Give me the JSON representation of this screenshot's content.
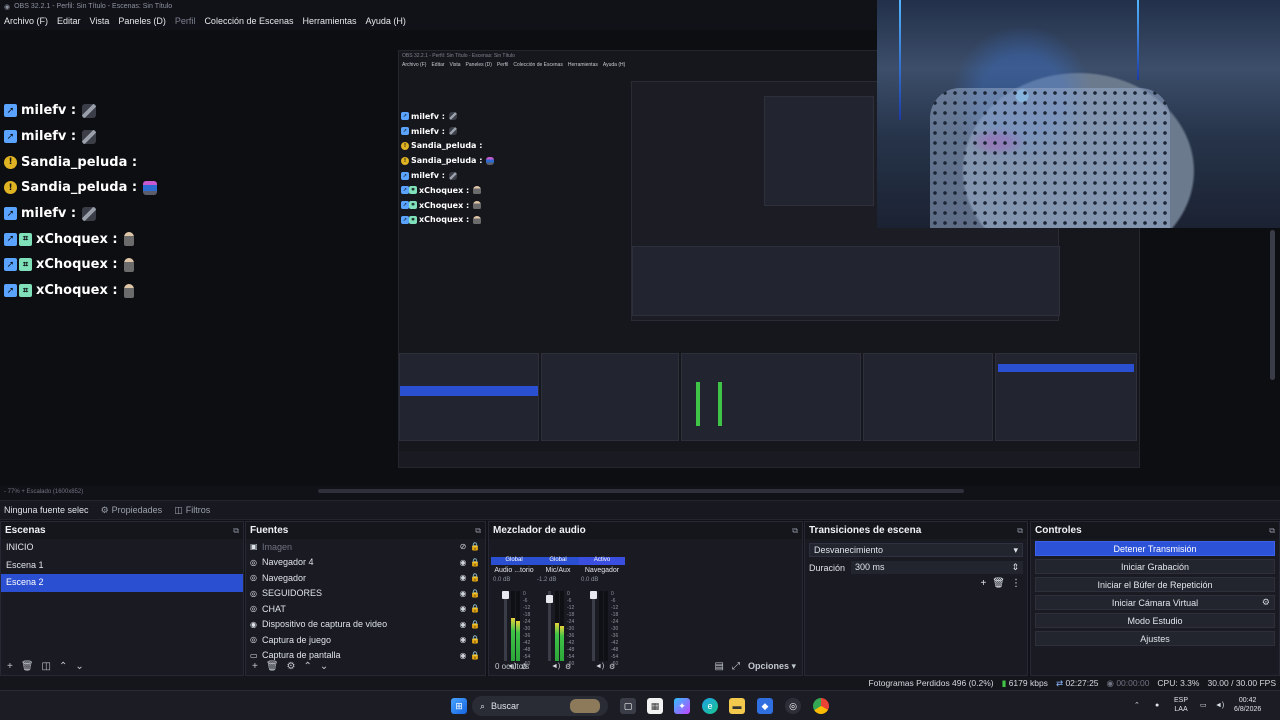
{
  "window": {
    "title": "OBS 32.2.1 - Perfil: Sin Título - Escenas: Sin Título"
  },
  "menu": [
    {
      "label": "Archivo (F)",
      "dim": false
    },
    {
      "label": "Editar",
      "dim": false
    },
    {
      "label": "Vista",
      "dim": false
    },
    {
      "label": "Paneles (D)",
      "dim": false
    },
    {
      "label": "Perfil",
      "dim": true
    },
    {
      "label": "Colección de Escenas",
      "dim": false
    },
    {
      "label": "Herramientas",
      "dim": false
    },
    {
      "label": "Ayuda (H)",
      "dim": false
    }
  ],
  "chat": [
    {
      "user": "milefv :",
      "badges": [
        "prime"
      ],
      "emote": "sword"
    },
    {
      "user": "milefv :",
      "badges": [
        "prime"
      ],
      "emote": "sword"
    },
    {
      "user": "Sandia_peluda :",
      "badges": [
        "sub"
      ],
      "emote": "none"
    },
    {
      "user": "Sandia_peluda :",
      "badges": [
        "sub"
      ],
      "emote": "robo"
    },
    {
      "user": "milefv :",
      "badges": [
        "prime"
      ],
      "emote": "sword"
    },
    {
      "user": "xChoquex :",
      "badges": [
        "prime",
        "extra"
      ],
      "emote": "fig"
    },
    {
      "user": "xChoquex :",
      "badges": [
        "prime",
        "extra"
      ],
      "emote": "fig"
    },
    {
      "user": "xChoquex :",
      "badges": [
        "prime",
        "extra"
      ],
      "emote": "fig"
    }
  ],
  "preview_strip": {
    "zoom": "- 77% + Escalado (1600x852)"
  },
  "propbar": {
    "selected": "Ninguna fuente selec",
    "properties": "Propiedades",
    "filters": "Filtros"
  },
  "scenes": {
    "title": "Escenas",
    "items": [
      {
        "label": "INICIO",
        "selected": false
      },
      {
        "label": "Escena 1",
        "selected": false
      },
      {
        "label": "Escena 2",
        "selected": true
      }
    ]
  },
  "sources": {
    "title": "Fuentes",
    "items": [
      {
        "label": "Imagen",
        "icon": "image-icon",
        "dim": true
      },
      {
        "label": "Navegador 4",
        "icon": "globe-icon",
        "dim": false
      },
      {
        "label": "Navegador",
        "icon": "globe-icon",
        "dim": false
      },
      {
        "label": "SEGUIDORES",
        "icon": "globe-icon",
        "dim": false
      },
      {
        "label": "CHAT",
        "icon": "globe-icon",
        "dim": false
      },
      {
        "label": "Dispositivo de captura de video",
        "icon": "camera-icon",
        "dim": false
      },
      {
        "label": "Captura de juego",
        "icon": "gamepad-icon",
        "dim": false
      },
      {
        "label": "Captura de pantalla",
        "icon": "monitor-icon",
        "dim": false
      }
    ]
  },
  "mixer": {
    "title": "Mezclador de audio",
    "channels": [
      {
        "tag": "Global",
        "name": "Audio ...torio",
        "db": "0.0 dB",
        "level": 0.62
      },
      {
        "tag": "Global",
        "name": "Mic/Aux",
        "db": "-1.2 dB",
        "level": 0.55
      },
      {
        "tag": "Activo",
        "name": "Navegador",
        "db": "0.0 dB",
        "level": 0.0
      }
    ],
    "scale": [
      "0",
      "-6",
      "-12",
      "-18",
      "-24",
      "-30",
      "-36",
      "-42",
      "-48",
      "-54",
      "-60"
    ],
    "hidden": "0 oculto/s",
    "options": "Opciones"
  },
  "transitions": {
    "title": "Transiciones de escena",
    "type": "Desvanecimiento",
    "duration_label": "Duración",
    "duration_value": "300 ms"
  },
  "controls": {
    "title": "Controles",
    "buttons": [
      {
        "label": "Detener Transmisión",
        "primary": true
      },
      {
        "label": "Iniciar Grabación",
        "primary": false
      },
      {
        "label": "Iniciar el Búfer de Repetición",
        "primary": false
      },
      {
        "label": "Iniciar Cámara Virtual",
        "primary": false
      },
      {
        "label": "Modo Estudio",
        "primary": false
      },
      {
        "label": "Ajustes",
        "primary": false
      }
    ]
  },
  "status": {
    "dropped": "Fotogramas Perdidos 496 (0.2%)",
    "bitrate": "6179 kbps",
    "stream_time": "02:27:25",
    "rec_time": "00:00:00",
    "cpu": "CPU: 3.3%",
    "fps": "30.00 / 30.00 FPS"
  },
  "taskbar": {
    "search": "Buscar",
    "lang": "ESP",
    "lang2": "LAA",
    "time": "00:42",
    "date": "6/8/2026"
  },
  "colors": {
    "accent": "#2c52d8",
    "meter_green": "#3fc447",
    "bg": "#111217"
  }
}
